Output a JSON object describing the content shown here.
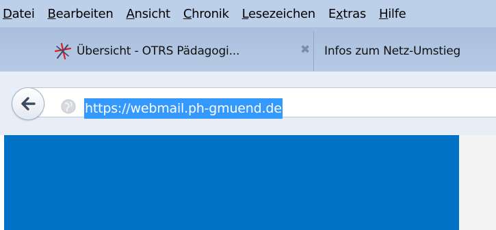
{
  "menubar": {
    "items": [
      {
        "accel": "D",
        "rest": "atei"
      },
      {
        "accel": "B",
        "rest": "earbeiten"
      },
      {
        "accel": "A",
        "rest": "nsicht"
      },
      {
        "accel": "C",
        "rest": "hronik"
      },
      {
        "accel": "L",
        "rest": "esezeichen"
      },
      {
        "pre": "E",
        "accel": "x",
        "rest": "tras"
      },
      {
        "accel": "H",
        "rest": "ilfe"
      }
    ]
  },
  "tabs": [
    {
      "title": "Übersicht - OTRS Pädagogi...",
      "close_glyph": "✖",
      "favicon": "otrs-star-icon"
    },
    {
      "title": "Infos zum Netz-Umstieg"
    }
  ],
  "navbar": {
    "url": "https://webmail.ph-gmuend.de",
    "back_icon": "back-arrow-icon",
    "site_icon": "globe-icon"
  },
  "colors": {
    "menubar_bg": "#bcd0e9",
    "tabstrip_bg": "#b0c4e0",
    "url_selection": "#3399ff",
    "content_panel": "#0072c6"
  }
}
